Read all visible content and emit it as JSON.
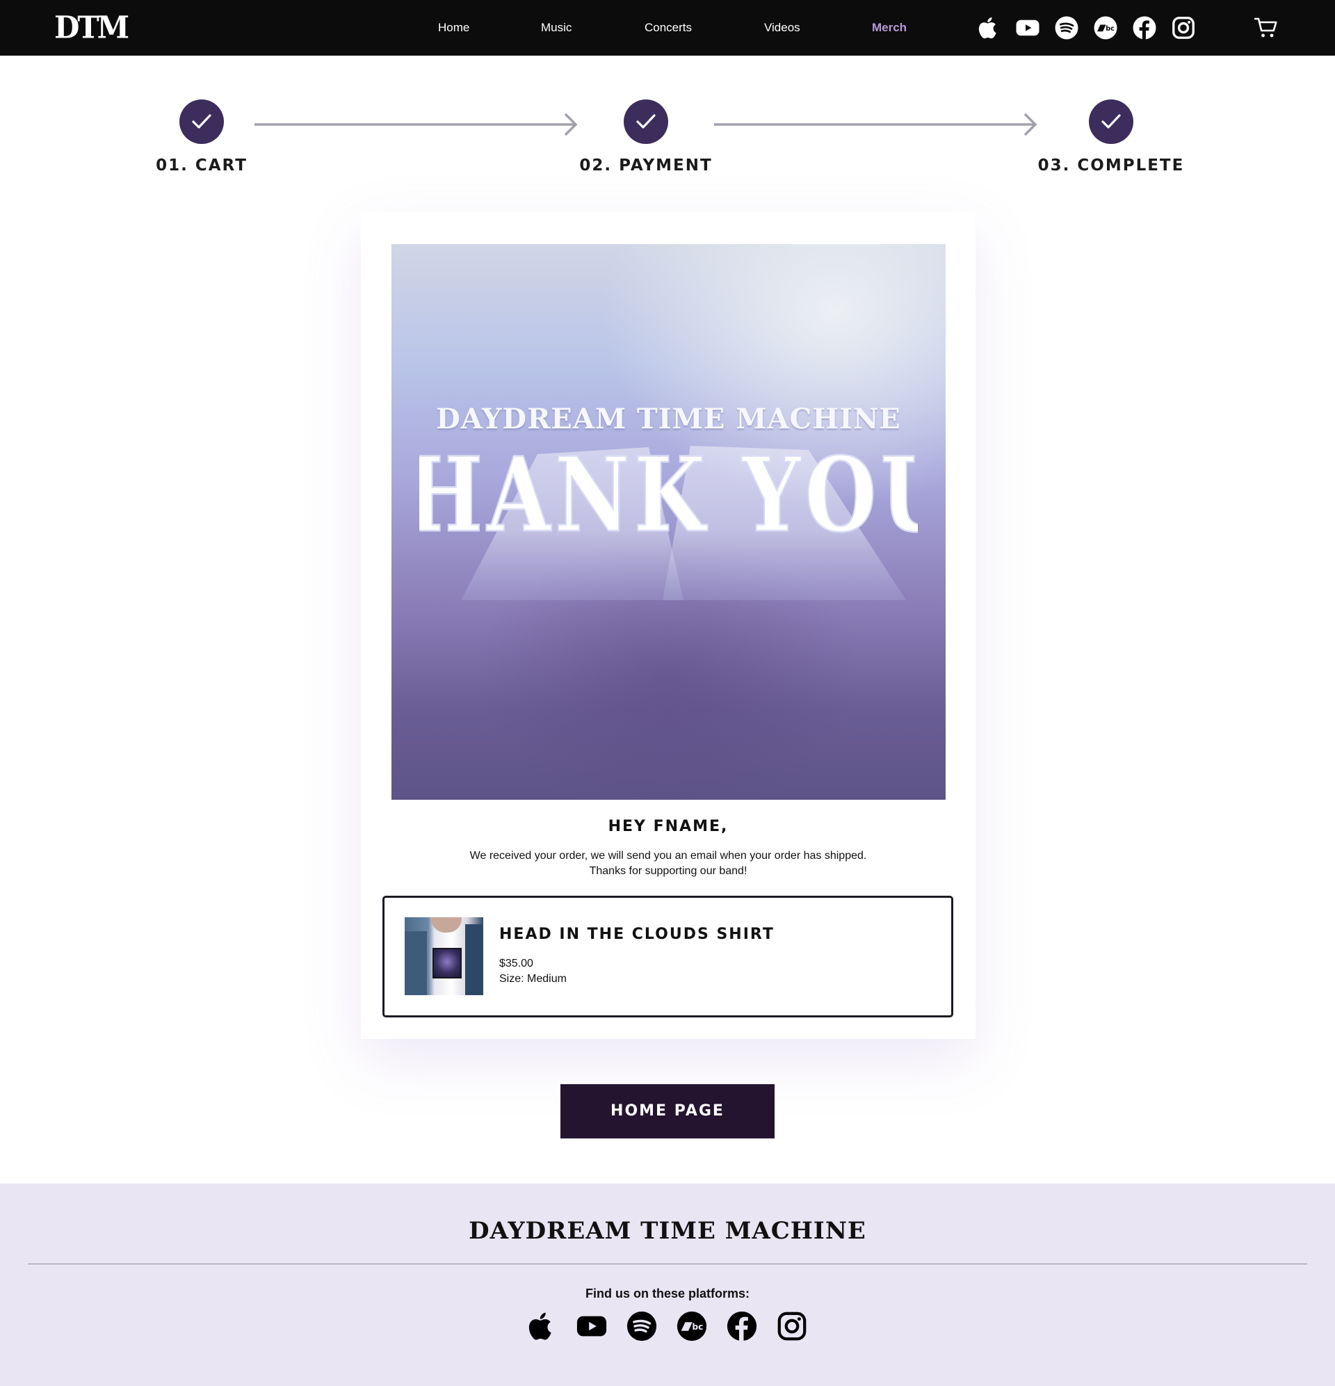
{
  "header": {
    "logo": "DTM",
    "nav": [
      {
        "label": "Home",
        "active": false
      },
      {
        "label": "Music",
        "active": false
      },
      {
        "label": "Concerts",
        "active": false
      },
      {
        "label": "Videos",
        "active": false
      },
      {
        "label": "Merch",
        "active": true
      }
    ],
    "social_icons": [
      "apple-music-icon",
      "youtube-icon",
      "spotify-icon",
      "bandcamp-icon",
      "facebook-icon",
      "instagram-icon"
    ],
    "cart_icon": "shopping-cart-icon"
  },
  "steps": [
    {
      "label": "01. CART",
      "complete": true
    },
    {
      "label": "02. PAYMENT",
      "complete": true
    },
    {
      "label": "03. COMPLETE",
      "complete": true
    }
  ],
  "hero": {
    "band": "DAYDREAM TIME MACHINE",
    "headline": "THANK YOU!"
  },
  "confirmation": {
    "greeting": "HEY FNAME,",
    "message_line1": "We received your order, we will send you an email when your order has shipped.",
    "message_line2": "Thanks for supporting our band!"
  },
  "order_item": {
    "name": "HEAD IN THE CLOUDS SHIRT",
    "price": "$35.00",
    "size": "Size: Medium"
  },
  "home_button": "HOME PAGE",
  "footer": {
    "title": "DAYDREAM TIME MACHINE",
    "platforms_text": "Find us on these platforms:",
    "social_icons": [
      "apple-music-icon",
      "youtube-icon",
      "spotify-icon",
      "bandcamp-icon",
      "facebook-icon",
      "instagram-icon"
    ]
  },
  "colors": {
    "header_bg": "#0c0c0c",
    "nav_active": "#b99bdb",
    "step_circle": "#3d2d5c",
    "button_bg": "#24142f",
    "footer_bg": "#e9e5f3"
  }
}
